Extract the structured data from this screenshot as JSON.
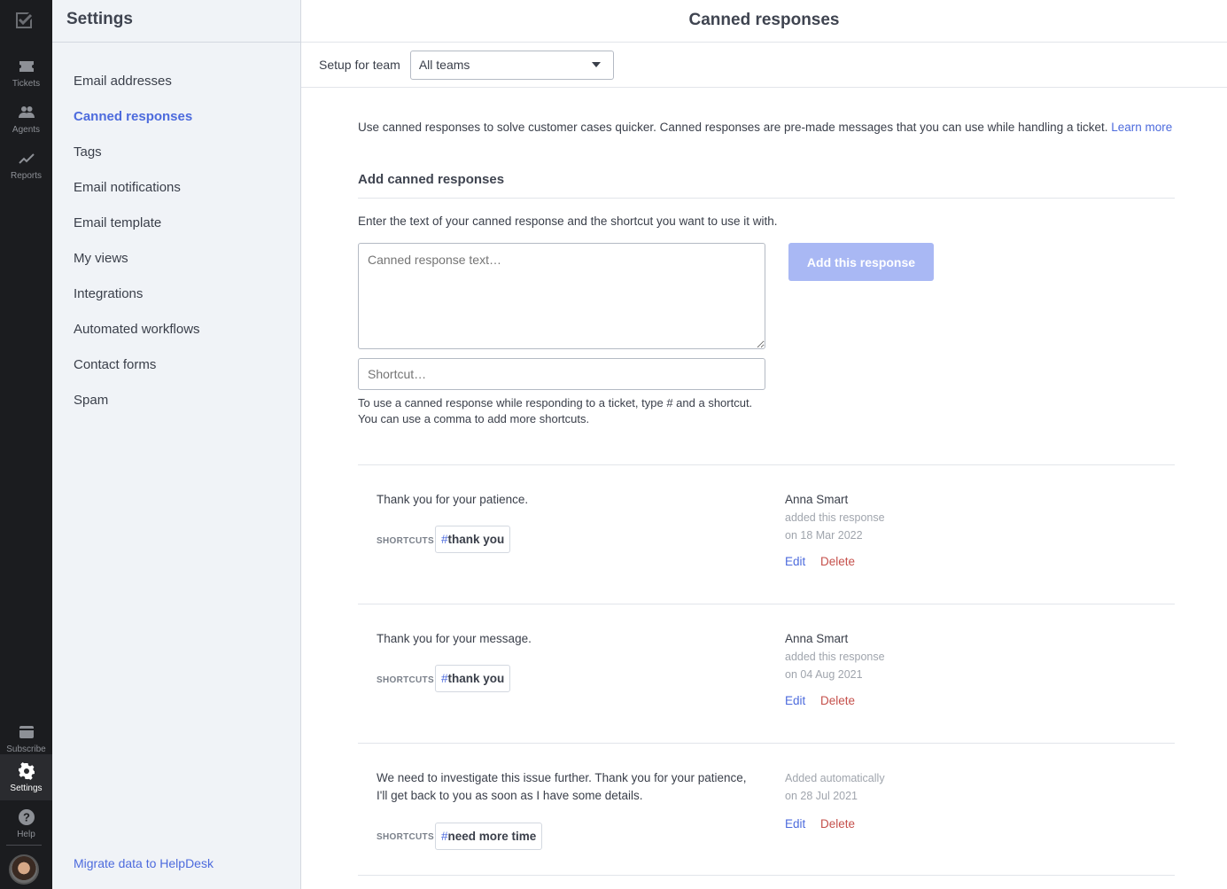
{
  "rail": {
    "items": [
      {
        "label": "Tickets",
        "icon": "ticket-icon"
      },
      {
        "label": "Agents",
        "icon": "agents-icon"
      },
      {
        "label": "Reports",
        "icon": "reports-icon"
      },
      {
        "label": "Subscribe",
        "icon": "card-icon"
      },
      {
        "label": "Settings",
        "icon": "gear-icon"
      },
      {
        "label": "Help",
        "icon": "help-icon"
      }
    ]
  },
  "sidebar": {
    "title": "Settings",
    "items": [
      {
        "label": "Email addresses"
      },
      {
        "label": "Canned responses",
        "active": true
      },
      {
        "label": "Tags"
      },
      {
        "label": "Email notifications"
      },
      {
        "label": "Email template"
      },
      {
        "label": "My views"
      },
      {
        "label": "Integrations"
      },
      {
        "label": "Automated workflows"
      },
      {
        "label": "Contact forms"
      },
      {
        "label": "Spam"
      }
    ],
    "footer_link": "Migrate data to HelpDesk"
  },
  "main": {
    "title": "Canned responses",
    "team_label": "Setup for team",
    "team_value": "All teams",
    "intro": "Use canned responses to solve customer cases quicker. Canned responses are pre-made messages that you can use while handling a ticket.",
    "learn_more": "Learn more",
    "section_title": "Add canned responses",
    "section_desc": "Enter the text of your canned response and the shortcut you want to use it with.",
    "textarea_placeholder": "Canned response text…",
    "shortcut_placeholder": "Shortcut…",
    "help_line1": "To use a canned response while responding to a ticket, type # and a shortcut.",
    "help_line2": "You can use a comma to add more shortcuts.",
    "add_button": "Add this response",
    "accent_color": "#4d6bdd",
    "danger_color": "#c5504b"
  },
  "responses": [
    {
      "message": "Thank you for your patience.",
      "shortcuts_label": "SHORTCUTS",
      "shortcut": "thank you",
      "author": "Anna Smart",
      "meta1": "added this response",
      "meta2": "on 18 Mar 2022",
      "edit": "Edit",
      "delete": "Delete"
    },
    {
      "message": "Thank you for your message.",
      "shortcuts_label": "SHORTCUTS",
      "shortcut": "thank you",
      "author": "Anna Smart",
      "meta1": "added this response",
      "meta2": "on 04 Aug 2021",
      "edit": "Edit",
      "delete": "Delete"
    },
    {
      "message": "We need to investigate this issue further. Thank you for your patience, I'll get back to you as soon as I have some details.",
      "shortcuts_label": "SHORTCUTS",
      "shortcut": "need more time",
      "meta1": "Added automatically",
      "meta2": "on 28 Jul 2021",
      "edit": "Edit",
      "delete": "Delete"
    }
  ]
}
